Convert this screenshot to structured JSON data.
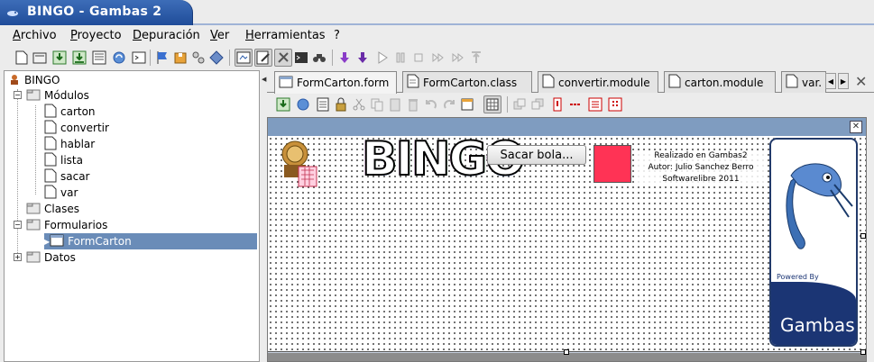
{
  "window": {
    "title": "BINGO - Gambas 2"
  },
  "menu": [
    "Archivo",
    "Proyecto",
    "Depuración",
    "Ver",
    "Herramientas",
    "?"
  ],
  "tree": {
    "root": "BINGO",
    "modules_folder": "Módulos",
    "modules": [
      "carton",
      "convertir",
      "hablar",
      "lista",
      "sacar",
      "var"
    ],
    "classes_folder": "Clases",
    "forms_folder": "Formularios",
    "selected_form": "FormCarton",
    "data_folder": "Datos"
  },
  "tabs": [
    "FormCarton.form",
    "FormCarton.class",
    "convertir.module",
    "carton.module",
    "var."
  ],
  "form": {
    "title_text": "BINGO",
    "button_label": "Sacar bola...",
    "credits": [
      "Realizado en Gambas2",
      "Autor: Julio Sanchez Berro",
      "Softwarelibre 2011"
    ],
    "logo_powered": "Powered By",
    "logo_name": "Gambas",
    "box_color": "#ff3355"
  },
  "colors": {
    "title_blue": "#2a5aa8",
    "selection": "#6a8cb8",
    "form_title": "#7f9cc0"
  }
}
